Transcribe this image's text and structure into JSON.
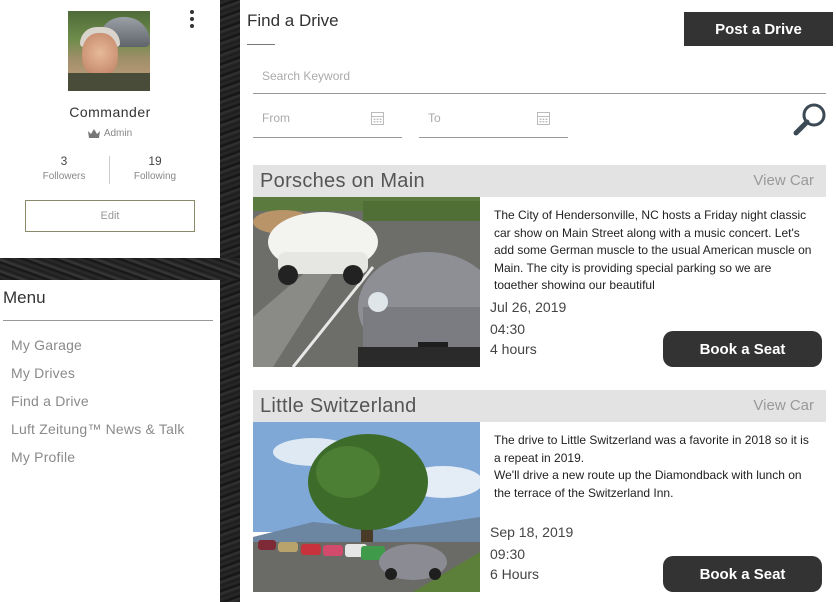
{
  "profile": {
    "name": "Commander",
    "role": "Admin",
    "followers_count": "3",
    "followers_label": "Followers",
    "following_count": "19",
    "following_label": "Following",
    "edit_label": "Edit"
  },
  "menu": {
    "title": "Menu",
    "items": [
      {
        "label": "My Garage"
      },
      {
        "label": "My Drives"
      },
      {
        "label": "Find a Drive"
      },
      {
        "label": "Luft Zeitung™ News & Talk"
      },
      {
        "label": "My Profile"
      }
    ]
  },
  "main": {
    "title": "Find a Drive",
    "post_button": "Post a Drive",
    "search_placeholder": "Search Keyword",
    "from_label": "From",
    "to_label": "To"
  },
  "drives": [
    {
      "title": "Porsches on Main",
      "view_car": "View Car",
      "description": "The City of Hendersonville, NC hosts a Friday night classic car show on Main Street along with a music concert. Let's add some German muscle to the usual American muscle on Main.  The city is providing special parking so we are together showing our beautiful",
      "date": "Jul 26, 2019",
      "time": "04:30",
      "duration": "4 hours",
      "book_label": "Book a Seat"
    },
    {
      "title": "Little Switzerland",
      "view_car": "View Car",
      "description": "The drive to Little Switzerland was a favorite in 2018 so it is a repeat in 2019.\nWe'll drive a new route up the Diamondback with lunch on the terrace of the Switzerland Inn.",
      "date": "Sep 18, 2019",
      "time": "09:30",
      "duration": "6 Hours",
      "book_label": "Book a Seat"
    }
  ],
  "colors": {
    "dark_button": "#333333",
    "card_header": "#e3e3e3",
    "muted_text": "#8a8a8a"
  },
  "icons": [
    "kebab-menu-icon",
    "crown-icon",
    "calendar-icon",
    "magnifier-icon"
  ]
}
